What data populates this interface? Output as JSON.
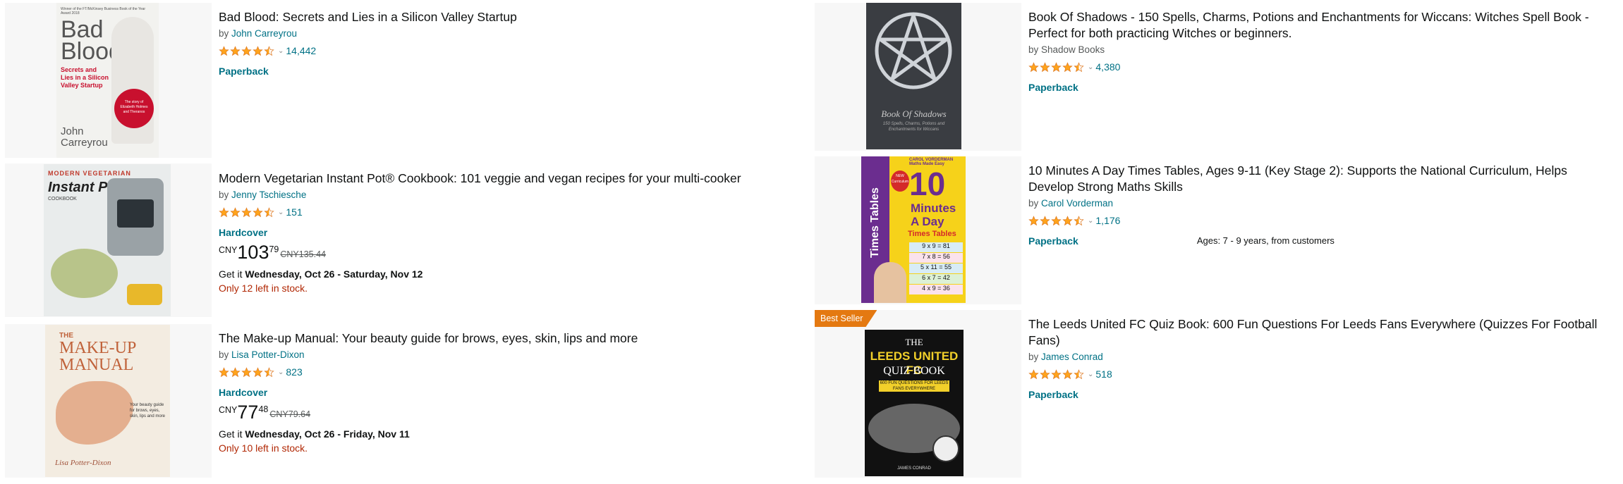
{
  "items": [
    {
      "title": "Bad Blood: Secrets and Lies in a Silicon Valley Startup",
      "by": "by ",
      "author": "John Carreyrou",
      "rating": 4.5,
      "reviews": "14,442",
      "format": "Paperback",
      "cover": {
        "line1": "Bad",
        "line2": "Blood",
        "sub": "Secrets and Lies in a Silicon Valley Startup",
        "author": "John Carreyrou",
        "top": "Winner of the FT/McKinsey Business Book of the Year Award 2018",
        "seal": "The story of Elizabeth Holmes and Theranos"
      }
    },
    {
      "title": "Modern Vegetarian Instant Pot® Cookbook: 101 veggie and vegan recipes for your multi-cooker",
      "by": "by ",
      "author": "Jenny Tschiesche",
      "rating": 4.5,
      "reviews": "151",
      "format": "Hardcover",
      "currency": "CNY",
      "price_whole": "103",
      "price_fraction": "79",
      "list_price": "CNY135.44",
      "delivery_prefix": "Get it ",
      "delivery_dates": "Wednesday, Oct 26 - Saturday, Nov 12",
      "stock": "Only 12 left in stock.",
      "cover": {
        "line1": "MODERN VEGETARIAN",
        "line2": "Instant Pot",
        "sub": "COOKBOOK"
      }
    },
    {
      "title": "The Make-up Manual: Your beauty guide for brows, eyes, skin, lips and more",
      "by": "by ",
      "author": "Lisa Potter-Dixon",
      "rating": 4.5,
      "reviews": "823",
      "format": "Hardcover",
      "currency": "CNY",
      "price_whole": "77",
      "price_fraction": "48",
      "list_price": "CNY79.64",
      "delivery_prefix": "Get it ",
      "delivery_dates": "Wednesday, Oct 26 - Friday, Nov 11",
      "stock": "Only 10 left in stock.",
      "cover": {
        "line1": "THE",
        "line2": "MAKE-UP",
        "line3": "MANUAL",
        "sub": "Your beauty guide for brows, eyes, skin, lips and more",
        "author": "Lisa Potter-Dixon"
      }
    },
    {
      "title": "Book Of Shadows - 150 Spells, Charms, Potions and Enchantments for Wiccans: Witches Spell Book - Perfect for both practicing Witches or beginners.",
      "by": "by ",
      "author": "Shadow Books",
      "rating": 4.5,
      "reviews": "4,380",
      "format": "Paperback",
      "cover": {
        "line1": "Book Of Shadows",
        "sub": "150 Spells, Charms, Potions and Enchantments for Wiccans"
      }
    },
    {
      "title": "10 Minutes A Day Times Tables, Ages 9-11 (Key Stage 2): Supports the National Curriculum, Helps Develop Strong Maths Skills",
      "by": "by ",
      "author": "Carol Vorderman",
      "rating": 4.5,
      "reviews": "1,176",
      "format": "Paperback",
      "ages": "Ages: 7 - 9 years, from customers",
      "cover": {
        "top": "CAROL VORDERMAN Maths Made Easy",
        "big": "10",
        "line1": "Minutes",
        "line2": "A Day",
        "line3": "Times Tables",
        "side": "Times Tables",
        "new": "NEW Curriculum",
        "rows": [
          "9 x 9 = 81",
          "7 x 8 = 56",
          "5 x 11 = 55",
          "6 x 7 = 42",
          "4 x 9 = 36"
        ]
      }
    },
    {
      "badge": "Best Seller",
      "title": "The Leeds United FC Quiz Book: 600 Fun Questions For Leeds Fans Everywhere (Quizzes For Football Fans)",
      "by": "by ",
      "author": "James Conrad",
      "rating": 4.5,
      "reviews": "518",
      "format": "Paperback",
      "cover": {
        "line1": "THE",
        "line2": "LEEDS UNITED FC",
        "line3": "QUIZ BOOK",
        "sub": "600 FUN QUESTIONS FOR LEEDS FANS EVERYWHERE",
        "author": "JAMES CONRAD"
      }
    }
  ],
  "colors": {
    "star": "#ffa41c",
    "link": "#007185",
    "stock": "#b12704",
    "badge": "#e47911"
  },
  "icons": {
    "star": "star-icon",
    "chevron": "chevron-down-icon"
  }
}
